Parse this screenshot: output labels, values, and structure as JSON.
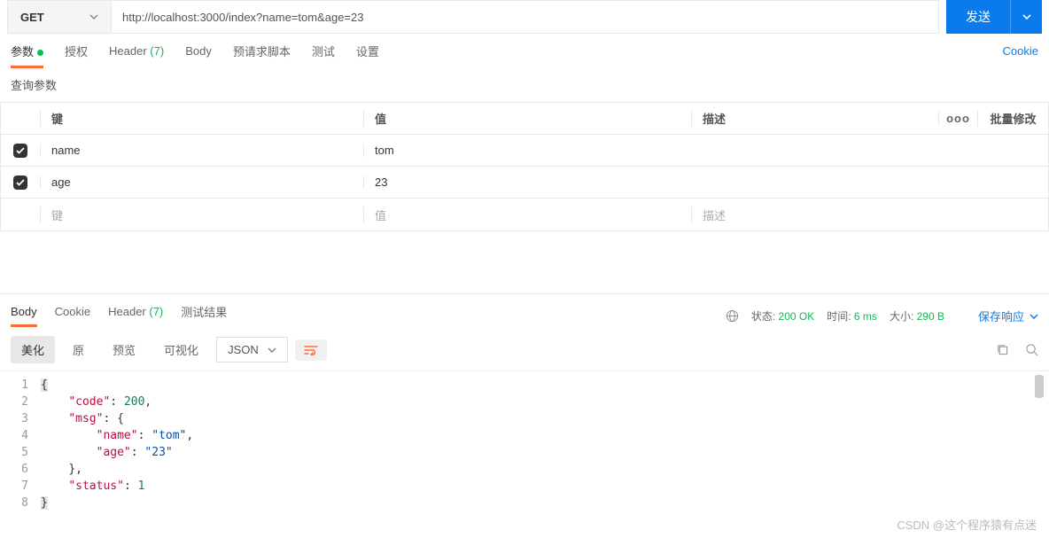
{
  "request": {
    "method": "GET",
    "url": "http://localhost:3000/index?name=tom&age=23",
    "send_label": "发送"
  },
  "tabs": {
    "params": "参数",
    "auth": "授权",
    "headers": "Header",
    "headers_count": "(7)",
    "body": "Body",
    "prerequest": "预请求脚本",
    "tests": "测试",
    "settings": "设置",
    "cookie": "Cookie"
  },
  "params_section": {
    "title": "查询参数",
    "columns": {
      "key": "键",
      "value": "值",
      "desc": "描述",
      "bulk": "批量修改"
    },
    "rows": [
      {
        "checked": true,
        "key": "name",
        "value": "tom",
        "desc": ""
      },
      {
        "checked": true,
        "key": "age",
        "value": "23",
        "desc": ""
      }
    ],
    "placeholder": {
      "key": "键",
      "value": "值",
      "desc": "描述"
    }
  },
  "response": {
    "tabs": {
      "body": "Body",
      "cookie": "Cookie",
      "headers": "Header",
      "headers_count": "(7)",
      "tests": "测试结果"
    },
    "status_label": "状态:",
    "status_value": "200 OK",
    "time_label": "时间:",
    "time_value": "6 ms",
    "size_label": "大小:",
    "size_value": "290 B",
    "save_label": "保存响应",
    "view": {
      "pretty": "美化",
      "raw": "原",
      "preview": "预览",
      "visualize": "可视化",
      "format": "JSON"
    },
    "code_lines": [
      "{",
      "    \"code\": 200,",
      "    \"msg\": {",
      "        \"name\": \"tom\",",
      "        \"age\": \"23\"",
      "    },",
      "    \"status\": 1",
      "}"
    ]
  },
  "watermark": "CSDN @这个程序猿有点迷"
}
